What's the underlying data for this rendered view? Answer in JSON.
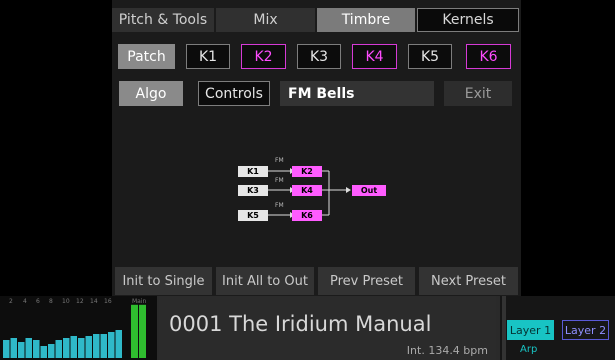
{
  "tabs": [
    {
      "label": "Pitch & Tools"
    },
    {
      "label": "Mix"
    },
    {
      "label": "Timbre"
    },
    {
      "label": "Kernels"
    }
  ],
  "patch_button": "Patch",
  "kernel_buttons": [
    "K1",
    "K2",
    "K3",
    "K4",
    "K5",
    "K6"
  ],
  "algo_button": "Algo",
  "controls_button": "Controls",
  "preset_field": "FM Bells",
  "exit_button": "Exit",
  "diagram": {
    "modulators": [
      "K1",
      "K3",
      "K5"
    ],
    "carriers": [
      "K2",
      "K4",
      "K6"
    ],
    "fm_label": "FM",
    "output": "Out"
  },
  "bottom_buttons": [
    "Init to Single",
    "Init All to Out",
    "Prev Preset",
    "Next Preset"
  ],
  "meter": {
    "scale_labels": [
      "2",
      "4",
      "6",
      "8",
      "10",
      "12",
      "14",
      "16",
      "Main"
    ],
    "levels": [
      0.45,
      0.5,
      0.4,
      0.5,
      0.45,
      0.3,
      0.35,
      0.45,
      0.5,
      0.55,
      0.5,
      0.55,
      0.6,
      0.6,
      0.65,
      0.7
    ],
    "main_level": 0.95
  },
  "status": {
    "preset_title": "0001 The Iridium Manual",
    "tempo": "Int. 134.4 bpm",
    "layer1": "Layer 1",
    "layer2": "Layer 2",
    "arp": "Arp"
  },
  "colors": {
    "accent_magenta": "#ff4cff",
    "layer_cyan": "#18c4c4",
    "meter_cyan": "#2fb9c9",
    "meter_green": "#2fbd2f"
  }
}
